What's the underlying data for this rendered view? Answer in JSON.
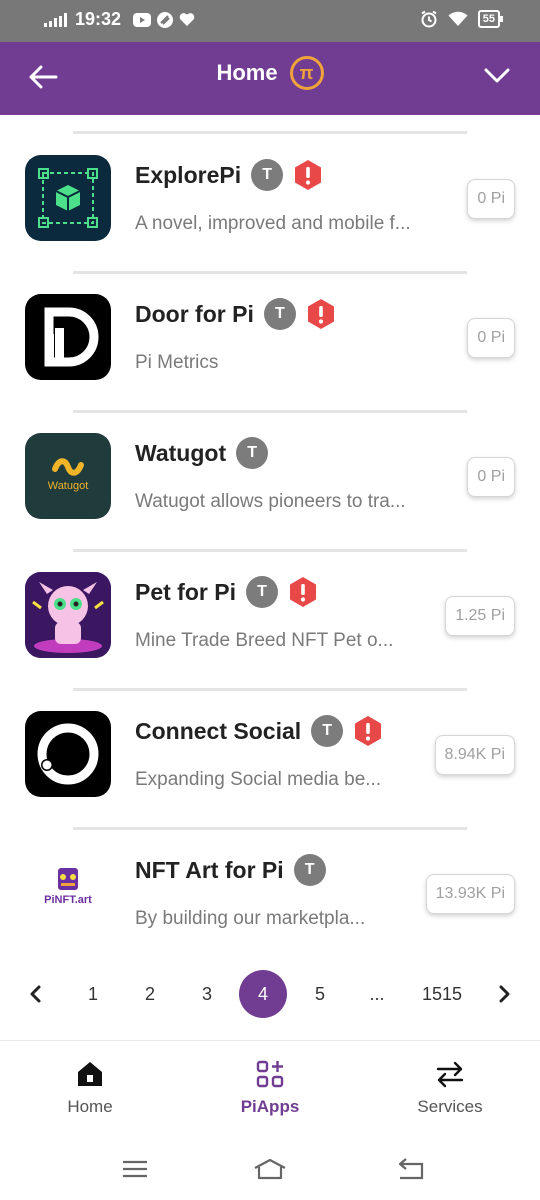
{
  "status_bar": {
    "time": "19:32",
    "battery": "55",
    "icons_left": [
      "youtube-icon",
      "helix-icon",
      "heart-icon"
    ],
    "icons_right": [
      "alarm-icon",
      "wifi-icon",
      "battery-icon"
    ]
  },
  "header": {
    "title": "Home",
    "logo_glyph": "π",
    "accent_color": "#703d92",
    "logo_color": "#f0a33b"
  },
  "apps": [
    {
      "name": "ExplorePi",
      "badge": "T",
      "warning": true,
      "description": "A novel, improved and mobile f...",
      "price": "0 Pi",
      "icon": "cube-network-icon"
    },
    {
      "name": "Door for Pi",
      "badge": "T",
      "warning": true,
      "description": "Pi Metrics",
      "price": "0 Pi",
      "icon": "door-logo-icon"
    },
    {
      "name": "Watugot",
      "badge": "T",
      "warning": false,
      "description": "Watugot allows pioneers to tra...",
      "price": "0 Pi",
      "icon": "watugot-logo-icon",
      "icon_text": "Watugot"
    },
    {
      "name": "Pet for Pi",
      "badge": "T",
      "warning": true,
      "description": "Mine Trade Breed NFT Pet o...",
      "price": "1.25 Pi",
      "icon": "pet-nft-icon"
    },
    {
      "name": "Connect Social",
      "badge": "T",
      "warning": true,
      "description": "Expanding Social media be...",
      "price": "8.94K Pi",
      "icon": "connect-ring-icon"
    },
    {
      "name": "NFT Art for Pi",
      "badge": "T",
      "warning": false,
      "description": "By building our marketpla...",
      "price": "13.93K Pi",
      "icon": "pinft-art-icon",
      "icon_text": "PiNFT.art"
    }
  ],
  "pagination": {
    "prev": "‹",
    "next": "›",
    "pages": [
      "1",
      "2",
      "3",
      "4",
      "5",
      "...",
      "1515"
    ],
    "current": "4"
  },
  "bottom_nav": [
    {
      "label": "Home",
      "icon": "home-icon",
      "active": false
    },
    {
      "label": "PiApps",
      "icon": "apps-grid-icon",
      "active": true
    },
    {
      "label": "Services",
      "icon": "swap-arrows-icon",
      "active": false
    }
  ],
  "system_nav": [
    "menu-icon",
    "home-outline-icon",
    "back-icon"
  ]
}
